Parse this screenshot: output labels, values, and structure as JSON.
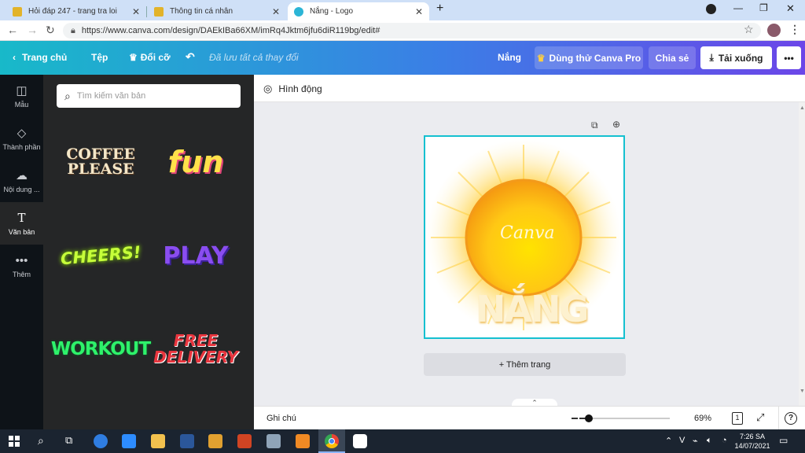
{
  "browser": {
    "tabs": [
      {
        "title": "Hỏi đáp 247 - trang tra loi"
      },
      {
        "title": "Thông tin cá nhân"
      },
      {
        "title": "Nắng - Logo"
      }
    ],
    "url": "https://www.canva.com/design/DAEkIBa66XM/imRq4Jktm6jfu6diR119bg/edit#"
  },
  "canva_bar": {
    "home": "Trang chủ",
    "file": "Tệp",
    "resize": "Đổi cỡ",
    "saved_status": "Đã lưu tất cả thay đổi",
    "design_name": "Nắng",
    "try_pro": "Dùng thử Canva Pro",
    "share": "Chia sẻ",
    "download": "Tải xuống",
    "more": "•••"
  },
  "rail": {
    "items": [
      {
        "label": "Mẫu",
        "icon": "template-icon"
      },
      {
        "label": "Thành phần",
        "icon": "elements-icon"
      },
      {
        "label": "Nội dung ...",
        "icon": "upload-icon"
      },
      {
        "label": "Văn bản",
        "icon": "text-icon"
      },
      {
        "label": "Thêm",
        "icon": "more-icon"
      }
    ]
  },
  "panel": {
    "search_placeholder": "Tìm kiếm văn bản",
    "styles": [
      {
        "text": "COFFEE\nPLEASE",
        "color": "#f4e7c8"
      },
      {
        "text": "fun",
        "color": "#ffe14a"
      },
      {
        "text": "CHEERS!",
        "color": "#c6ff3a"
      },
      {
        "text": "PLAY",
        "color": "#8a4df0"
      },
      {
        "text": "WORKOUT",
        "color": "#2ef26b"
      },
      {
        "text": "FREE\nDELIVERY",
        "color": "#e8353e"
      }
    ]
  },
  "workspace": {
    "animate": "Hình động",
    "design_watermark": "Canva",
    "design_text": "NẮNG",
    "add_page": "+ Thêm trang"
  },
  "bottom": {
    "notes": "Ghi chú",
    "zoom": "69%",
    "zoom_fraction": 0.1,
    "page_count": "1",
    "help": "?"
  },
  "taskbar": {
    "time": "7:26 SA",
    "date": "14/07/2021",
    "lang": "V"
  }
}
